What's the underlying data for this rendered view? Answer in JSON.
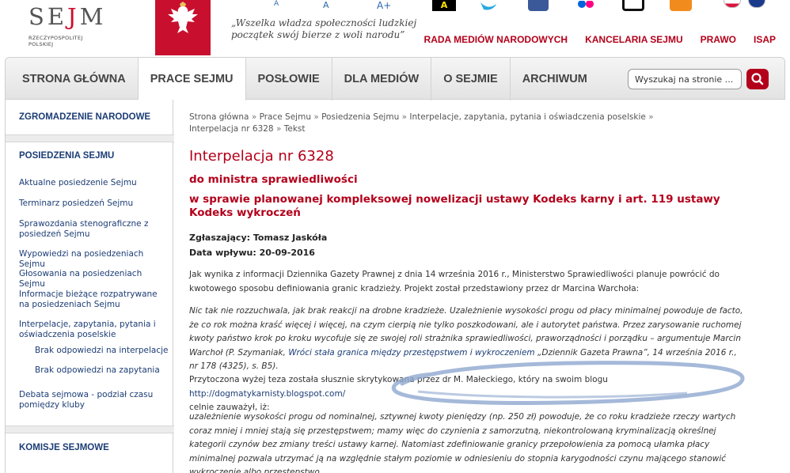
{
  "header": {
    "logo_main": "SE",
    "logo_j": "J",
    "logo_end": "M",
    "logo_sub": "RZECZYPOSPOLITEJ POLSKIEJ",
    "motto": "„Wszelka władza społeczności ludzkiej początek swój bierze z woli narodu”",
    "text_size_labels": [
      "A",
      "A",
      "A+"
    ],
    "contrast_label": "A",
    "social_icons": [
      "twitter-icon",
      "facebook-icon",
      "flickr-icon",
      "instagram-icon",
      "rss-icon"
    ],
    "top_links": [
      "RADA MEDIÓW NARODOWYCH",
      "KANCELARIA SEJMU",
      "PRAWO",
      "ISAP"
    ],
    "colors": {
      "accent": "#b3001b",
      "link": "#1c3d75"
    }
  },
  "nav": {
    "tabs": [
      "STRONA GŁÓWNA",
      "PRACE SEJMU",
      "POSŁOWIE",
      "DLA MEDIÓW",
      "O SEJMIE",
      "ARCHIWUM"
    ],
    "active": "PRACE SEJMU",
    "search_placeholder": "Wyszukaj na stronie ..."
  },
  "sidebar": {
    "section1": "ZGROMADZENIE NARODOWE",
    "section2": "POSIEDZENIA SEJMU",
    "items": [
      "Aktualne posiedzenie Sejmu",
      "Terminarz posiedzeń Sejmu",
      "Sprawozdania stenograficzne z posiedzeń Sejmu",
      "Wypowiedzi na posiedzeniach Sejmu",
      "Głosowania na posiedzeniach Sejmu",
      "Informacje bieżące rozpatrywane na posiedzeniach Sejmu",
      "Interpelacje, zapytania, pytania i oświadczenia poselskie",
      "Brak odpowiedzi na interpelacje",
      "Brak odpowiedzi na zapytania",
      "Debata sejmowa - podział czasu pomiędzy kluby"
    ],
    "section3": "KOMISJE SEJMOWE"
  },
  "breadcrumb": [
    "Strona główna",
    "Prace Sejmu",
    "Posiedzenia Sejmu",
    "Interpelacje, zapytania, pytania i oświadczenia poselskie",
    "Interpelacja nr 6328",
    "Tekst"
  ],
  "article": {
    "title": "Interpelacja nr 6328",
    "addressee": "do ministra sprawiedliwości",
    "subject": "w sprawie planowanej kompleksowej nowelizacji ustawy Kodeks karny i art. 119 ustawy Kodeks wykroczeń",
    "submitter": "Zgłaszający: Tomasz Jaskóła",
    "date": "Data wpływu: 20-09-2016",
    "p1": "Jak wynika z informacji Dziennika Gazety Prawnej z dnia 14 września 2016 r., Ministerstwo Sprawiedliwości planuje powrócić do kwotowego sposobu definiowania granic kradzieży. Projekt został przedstawiony przez dr Marcina Warchoła:",
    "p2": "Nic tak nie rozzuchwala, jak brak reakcji na drobne kradzieże. Uzależnienie wysokości progu od płacy minimalnej powoduje de facto, że co rok można kraść więcej i więcej, na czym cierpią nie tylko poszkodowani, ale i autorytet państwa. Przez zarysowanie ruchomej kwoty państwo krok po kroku wycofuje się ze swojej roli strażnika sprawiedliwości, praworządności i porządku – argumentuje Marcin Warchoł (P. Szymaniak,",
    "p2_link": "Wróci stała granica między przestępstwem i wykroczeniem",
    "p2_end": " „Dziennik Gazeta Prawna”, 14 września 2016 r., nr 178 (4325), s. B5).",
    "p3": "Przytoczona wyżej teza została słusznie skrytykowana przez dr M. Małeckiego, który na swoim blogu ",
    "p3_link": "http://dogmatykarnisty.blogspot.com/",
    "p3_end": "celnie zauważył, iż:",
    "p4": "uzależnienie wysokości progu od nominalnej, sztywnej kwoty pieniędzy (np. 250 zł) powoduje, że co roku kradzieże rzeczy wartych coraz mniej i mniej stają się przestępstwem; mamy więc do czynienia z samorzutną, niekontrolowaną kryminalizacją określnej kategorii czynów bez zmiany treści ustawy karnej. Natomiast zdefiniowanie granicy przepołowienia za pomocą ułamka płacy minimalnej pozwala utrzymać ją na względnie stałym poziomie w odniesieniu do stopnia karygodności czynu mającego stanowić wykroczenie albo przestępstwo."
  }
}
